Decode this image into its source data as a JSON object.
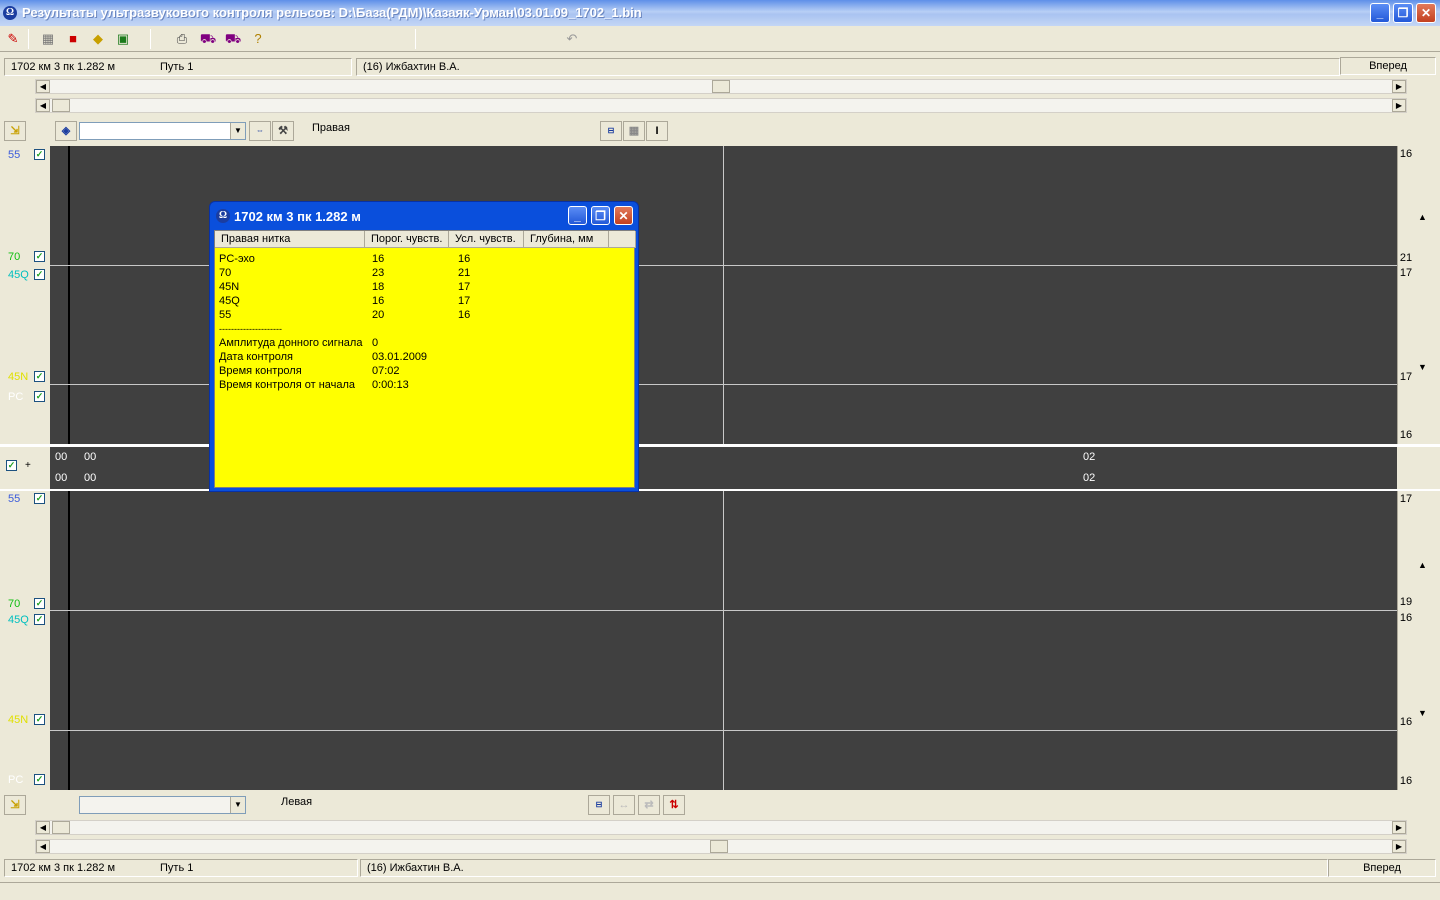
{
  "window": {
    "title": "Результаты ультразвукового контроля рельсов: D:\\База(РДМ)\\Казаяк-Урман\\03.01.09_1702_1.bin",
    "minimize": "_",
    "restore": "❐",
    "close": "✕"
  },
  "status_top": {
    "position": "1702 км 3 пк  1.282 м",
    "track": "Путь 1",
    "operator": "(16) Ижбахтин В.А.",
    "direction": "Вперед"
  },
  "status_bottom": {
    "position": "1702 км 3 пк  1.282 м",
    "track": "Путь 1",
    "operator": "(16) Ижбахтин В.А.",
    "direction": "Вперед"
  },
  "right_panel": {
    "label": "Правая",
    "combo_value": ""
  },
  "left_panel": {
    "label": "Левая",
    "combo_value": ""
  },
  "right_channels": [
    {
      "name": "55",
      "color": "#3b5bdb"
    },
    {
      "name": "70",
      "color": "#0fbf0f"
    },
    {
      "name": "45Q",
      "color": "#00bfbf"
    },
    {
      "name": "45N",
      "color": "#e0e000"
    },
    {
      "name": "PC",
      "color": "#ffffff"
    }
  ],
  "left_channels": [
    {
      "name": "55",
      "color": "#3b5bdb"
    },
    {
      "name": "70",
      "color": "#0fbf0f"
    },
    {
      "name": "45Q",
      "color": "#00bfbf"
    },
    {
      "name": "45N",
      "color": "#e0e000"
    },
    {
      "name": "PC",
      "color": "#ffffff"
    }
  ],
  "right_scale": {
    "top": [
      "16",
      "21",
      "17",
      "17",
      "16"
    ]
  },
  "left_scale": {
    "bottom": [
      "17",
      "19",
      "16",
      "16",
      "16"
    ]
  },
  "middle_strip": {
    "plus": "+",
    "row1": [
      "00",
      "00",
      "02"
    ],
    "row2": [
      "00",
      "00",
      "02"
    ]
  },
  "popup": {
    "title": "1702 км 3 пк  1.282 м",
    "columns": [
      "Правая нитка",
      "Порог. чувств.",
      "Усл. чувств.",
      "Глубина, мм"
    ],
    "rows": [
      [
        "PC-эхо",
        "16",
        "16"
      ],
      [
        "70",
        "23",
        "21"
      ],
      [
        "45N",
        "18",
        "17"
      ],
      [
        "45Q",
        "16",
        "17"
      ],
      [
        "55",
        "20",
        "16"
      ]
    ],
    "separator": "---------------------",
    "info": [
      [
        "Амплитуда донного сигнала",
        "0"
      ],
      [
        "Дата контроля",
        "03.01.2009"
      ],
      [
        "Время контроля",
        "07:02"
      ],
      [
        "Время контроля от начала",
        "0:00:13"
      ]
    ]
  },
  "icons": {
    "arrow_up": "▲",
    "arrow_down": "▼",
    "arrow_left": "◀",
    "arrow_right": "▶"
  }
}
